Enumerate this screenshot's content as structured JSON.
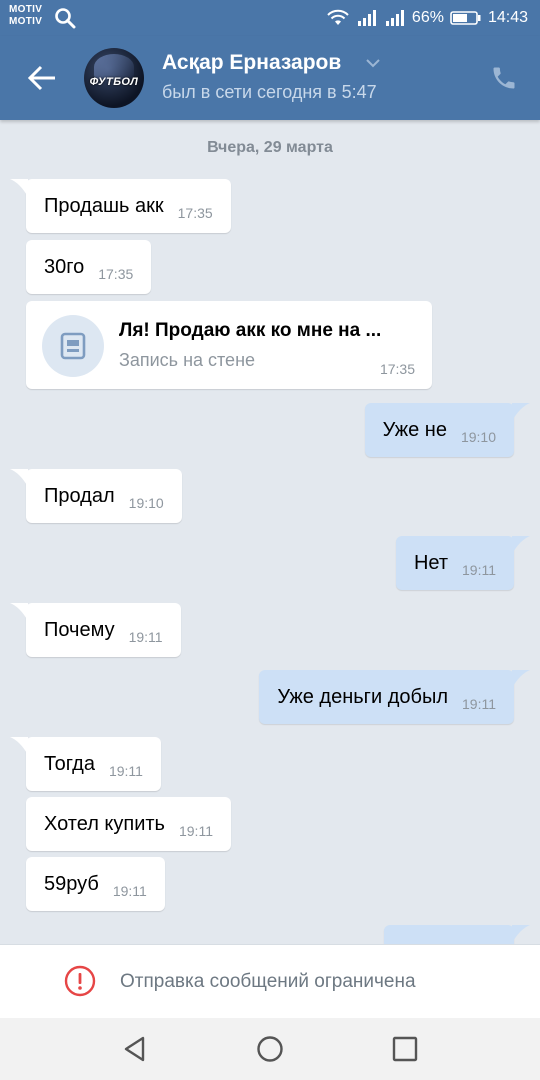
{
  "status_bar": {
    "carrier_1": "MOTIV",
    "carrier_2": "MOTIV",
    "battery": "66%",
    "time": "14:43"
  },
  "header": {
    "avatar_text": "ФУТБОЛ",
    "contact_name": "Асқар Ерназаров",
    "online_status": "был в сети сегодня в 5:47"
  },
  "chat": {
    "date_divider": "Вчера, 29 марта",
    "messages": [
      {
        "text": "Продашь акк",
        "time": "17:35",
        "direction": "in"
      },
      {
        "text": "30го",
        "time": "17:35",
        "direction": "in"
      },
      {
        "text": "Уже не",
        "time": "19:10",
        "direction": "out"
      },
      {
        "text": "Продал",
        "time": "19:10",
        "direction": "in"
      },
      {
        "text": "Нет",
        "time": "19:11",
        "direction": "out"
      },
      {
        "text": "Почему",
        "time": "19:11",
        "direction": "in"
      },
      {
        "text": "Уже деньги добыл",
        "time": "19:11",
        "direction": "out"
      },
      {
        "text": "Тогда",
        "time": "19:11",
        "direction": "in"
      },
      {
        "text": "Хотел купить",
        "time": "19:11",
        "direction": "in"
      },
      {
        "text": "59руб",
        "time": "19:11",
        "direction": "in"
      }
    ],
    "wall_post": {
      "title": "Ля! Продаю акк ко мне на ...",
      "subtitle": "Запись на стене",
      "time": "17:35"
    }
  },
  "restriction": {
    "text": "Отправка сообщений ограничена"
  },
  "colors": {
    "header": "#4a76a8",
    "background": "#e3e8ee",
    "incoming": "#ffffff",
    "outgoing": "#cde0f6",
    "warning": "#e64646"
  }
}
